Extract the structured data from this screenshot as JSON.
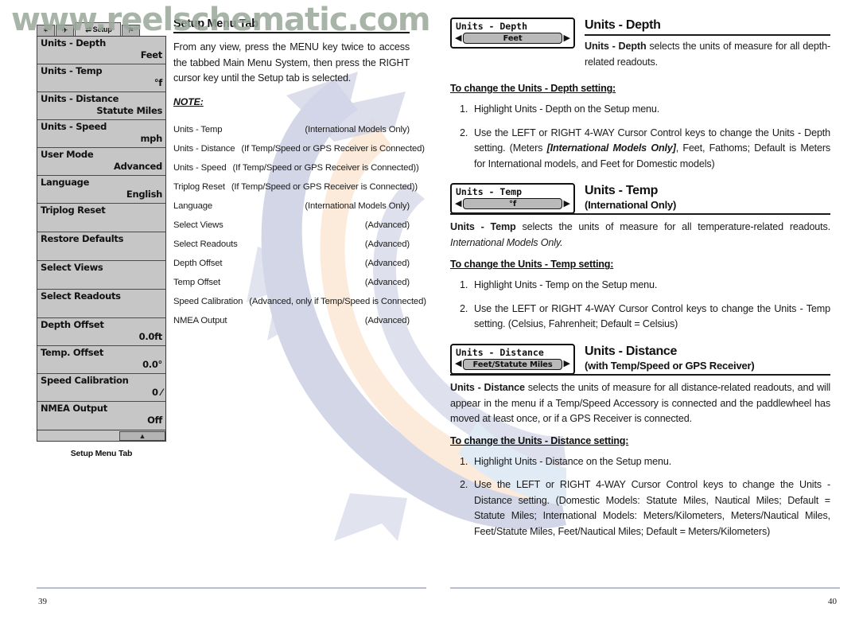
{
  "watermark": {
    "top_text": "www.reelschematic.com"
  },
  "left_page": {
    "page_number": "39",
    "lcd": {
      "tabs": [
        {
          "name": "alarms-tab",
          "glyph": "✶"
        },
        {
          "name": "sonar-tab",
          "glyph": "✈"
        },
        {
          "name": "setup-tab",
          "glyph": "⇄",
          "label": "Setup"
        },
        {
          "name": "views-tab",
          "glyph": "⚑"
        }
      ],
      "rows": [
        {
          "label": "Units - Depth",
          "value": "Feet"
        },
        {
          "label": "Units  -  Temp",
          "value": "°f"
        },
        {
          "label": "Units - Distance",
          "value": "Statute Miles"
        },
        {
          "label": "Units - Speed",
          "value": "mph"
        },
        {
          "label": "User Mode",
          "value": "Advanced"
        },
        {
          "label": "Language",
          "value": "English"
        },
        {
          "label": "Triplog Reset",
          "value": ""
        },
        {
          "label": "Restore Defaults",
          "value": ""
        },
        {
          "label": "Select Views",
          "value": ""
        },
        {
          "label": "Select Readouts",
          "value": ""
        },
        {
          "label": "Depth Offset",
          "value": "0.0ft"
        },
        {
          "label": "Temp. Offset",
          "value": "0.0°"
        },
        {
          "label": "Speed Calibration",
          "value": "0 ⁄"
        },
        {
          "label": "NMEA Output",
          "value": "Off"
        }
      ],
      "scroll_glyph": "▲",
      "caption": "Setup Menu Tab"
    },
    "section_title": "Setup Menu Tab",
    "intro": "From any view, press the MENU key twice to access the tabbed Main Menu System, then press the RIGHT cursor key until the Setup tab is selected.",
    "note_heading": "NOTE:",
    "note_items": [
      {
        "name": "Units - Temp",
        "condition": "(International Models Only)"
      },
      {
        "name": "Units - Distance",
        "condition": "(If Temp/Speed or GPS Receiver is Connected)"
      },
      {
        "name": "Units - Speed",
        "condition": "(If Temp/Speed or GPS Receiver is Connected))"
      },
      {
        "name": "Triplog Reset",
        "condition": "(If Temp/Speed or GPS Receiver is Connected))"
      },
      {
        "name": "Language",
        "condition": "(International Models Only)"
      },
      {
        "name": "Select Views",
        "condition": "(Advanced)"
      },
      {
        "name": "Select Readouts",
        "condition": "(Advanced)"
      },
      {
        "name": "Depth Offset",
        "condition": "(Advanced)"
      },
      {
        "name": "Temp Offset",
        "condition": "(Advanced)"
      },
      {
        "name": "Speed Calibration",
        "condition": "(Advanced, only if Temp/Speed is Connected)"
      },
      {
        "name": "NMEA Output",
        "condition": "(Advanced)"
      }
    ]
  },
  "right_page": {
    "page_number": "40",
    "sections": [
      {
        "widget": {
          "title": "Units  -  Depth",
          "value": "Feet",
          "left_arrow": "◀",
          "right_arrow": "▶"
        },
        "heading": "Units - Depth",
        "subheading": "",
        "description_html": "<b>Units - Depth</b> selects the units of measure for all depth-related readouts.",
        "sub_head": "To change the Units - Depth setting:",
        "steps_html": [
          "Highlight Units - Depth on the Setup menu.",
          "Use the LEFT or RIGHT 4-WAY Cursor Control keys to change the Units - Depth setting. (Meters <i>[International Models Only]</i>, Feet, Fathoms; Default is Meters for International models, and Feet for Domestic models)"
        ]
      },
      {
        "widget": {
          "title": "Units  -  Temp",
          "value": "°f",
          "left_arrow": "◀",
          "right_arrow": "▶"
        },
        "heading": "Units - Temp",
        "subheading": "(International Only)",
        "description_html": "<b>Units - Temp</b> selects the units of measure for all temperature-related readouts. <i>International Models Only.</i>",
        "sub_head": "To change the Units - Temp setting:",
        "steps_html": [
          "Highlight Units - Temp on the Setup menu.",
          "Use the LEFT or RIGHT 4-WAY Cursor Control keys to change the Units - Temp setting. (Celsius, Fahrenheit; Default = Celsius)"
        ]
      },
      {
        "widget": {
          "title": "Units  -  Distance",
          "value": "Feet/Statute  Miles",
          "left_arrow": "◀",
          "right_arrow": "▶"
        },
        "heading": "Units - Distance",
        "subheading": "(with Temp/Speed or GPS Receiver)",
        "description_html": "<b>Units - Distance</b> selects the units of measure for all distance-related readouts, and will appear in the menu if a Temp/Speed Accessory is connected and the paddlewheel has moved at least once, or if a GPS Receiver is connected.",
        "sub_head": "To change the Units - Distance setting:",
        "steps_html": [
          "Highlight Units - Distance on the Setup menu.",
          "Use the LEFT or RIGHT 4-WAY Cursor Control keys to change the Units - Distance setting. (Domestic Models: Statute Miles, Nautical Miles; Default = Statute Miles; International Models: Meters/Kilometers, Meters/Nautical Miles, Feet/Statute Miles, Feet/Nautical Miles; Default = Meters/Kilometers)"
        ]
      }
    ]
  },
  "colors": {
    "lcd_background": "#c6c6c6",
    "lcd_border": "#3a3a3a",
    "rule": "#1a1a1a",
    "footer_rule": "#b9bdd4",
    "watermark_text": "#9aa89a",
    "art_blue": "#b9bdd9",
    "art_peach": "#fbe0c4"
  }
}
